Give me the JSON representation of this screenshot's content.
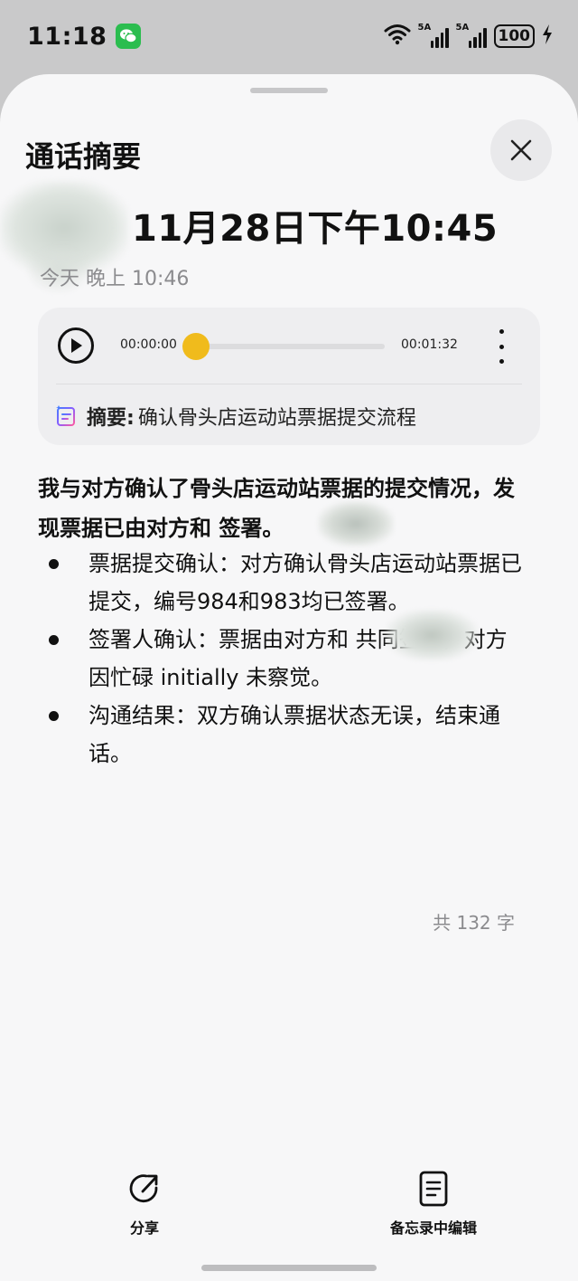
{
  "status_bar": {
    "time": "11:18",
    "notification_icon": "wechat-icon",
    "signal1_label": "5A",
    "signal2_label": "5A",
    "battery": "100"
  },
  "sheet": {
    "title": "通话摘要",
    "close_icon": "close-icon",
    "call_title": "11月28日下午10:45",
    "call_time": "今天 晚上 10:46",
    "player": {
      "time_start": "00:00:00",
      "time_end": "00:01:32",
      "progress": 0.0,
      "accent_color": "#f0bb1c",
      "summary_label": "摘要:",
      "summary_text": "确认骨头店运动站票据提交流程"
    },
    "lead": "我与对方确认了骨头店运动站票据的提交情况，发现票据已由对方和        签署。",
    "bullets": [
      "票据提交确认：对方确认骨头店运动站票据已提交，编号984和983均已签署。",
      "签署人确认：票据由对方和         共同签署，对方因忙碌 initially 未察觉。",
      "沟通结果：双方确认票据状态无误，结束通话。"
    ],
    "word_count": "共 132 字"
  },
  "actions": {
    "share": "分享",
    "edit_in_memo": "备忘录中编辑"
  }
}
